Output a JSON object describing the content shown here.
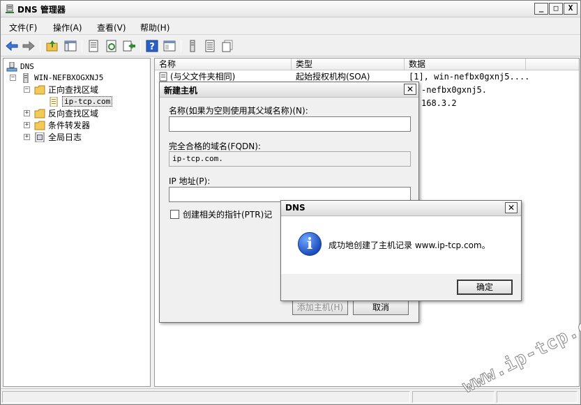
{
  "window": {
    "title": "DNS 管理器",
    "buttons": [
      "_",
      "□",
      "X"
    ]
  },
  "menu": [
    "文件(F)",
    "操作(A)",
    "查看(V)",
    "帮助(H)"
  ],
  "toolbar": [
    "back-icon",
    "forward-icon",
    "up-folder-icon",
    "show-tree-icon",
    "properties-icon",
    "refresh-icon",
    "export-icon",
    "help-icon",
    "console-icon",
    "server-icon",
    "list-icon",
    "copy-icon"
  ],
  "tree": {
    "root": "DNS",
    "server": "WIN-NEFBXOGXNJ5",
    "forward_zones": "正向查找区域",
    "zone": "ip-tcp.com",
    "reverse_zones": "反向查找区域",
    "conditional_forwarders": "条件转发器",
    "global_logs": "全局日志"
  },
  "list": {
    "columns": [
      "名称",
      "类型",
      "数据"
    ],
    "rows": [
      {
        "name": "(与父文件夹相同)",
        "type": "起始授权机构(SOA)",
        "data": "[1], win-nefbx0gxnj5...."
      },
      {
        "name": "",
        "type": "",
        "data": "-nefbx0gxnj5."
      },
      {
        "name": "",
        "type": "",
        "data": "168.3.2"
      }
    ]
  },
  "new_host_dialog": {
    "title": "新建主机",
    "name_label": "名称(如果为空则使用其父域名称)(N):",
    "name_value": "",
    "fqdn_label": "完全合格的域名(FQDN):",
    "fqdn_value": "ip-tcp.com.",
    "ip_label": "IP 地址(P):",
    "ip_value": "",
    "ptr_label": "创建相关的指针(PTR)记",
    "add_host_button": "添加主机(H)",
    "cancel_button": "取消"
  },
  "message_box": {
    "title": "DNS",
    "message": "成功地创建了主机记录 www.ip-tcp.com。",
    "ok_button": "确定"
  },
  "watermark": "www.ip-tcp.com"
}
